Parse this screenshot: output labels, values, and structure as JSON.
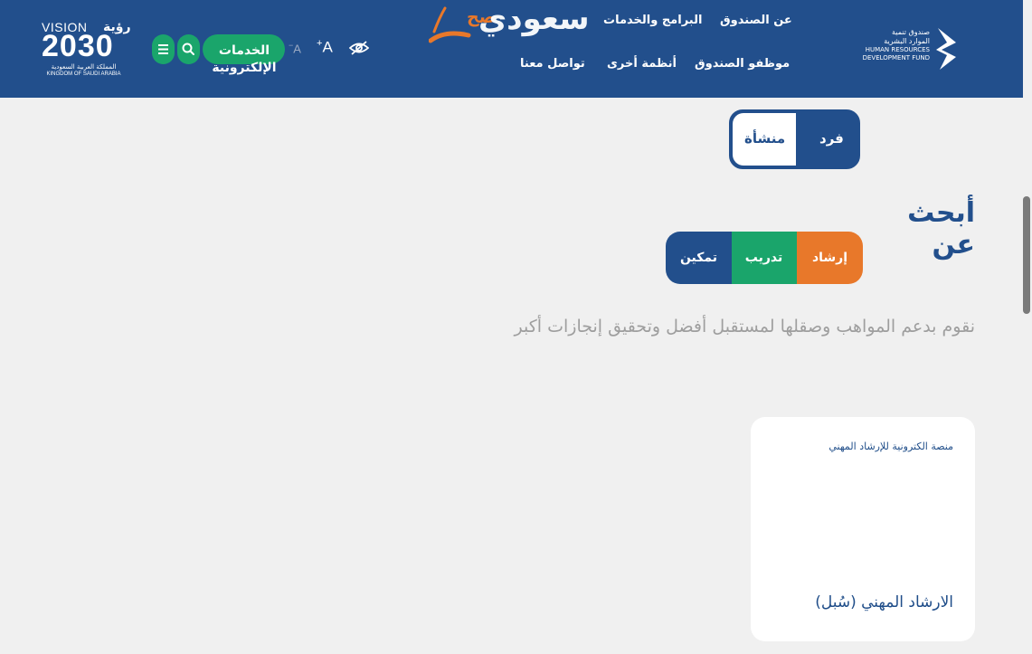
{
  "header": {
    "logo": {
      "ar_line1": "صندوق تنمية",
      "ar_line2": "الموارد البشرية",
      "en_line1": "HUMAN RESOURCES",
      "en_line2": "DEVELOPMENT FUND"
    },
    "nav": {
      "about": "عن الصندوق",
      "programs": "البرامج والخدمات",
      "employees": "موظفو الصندوق",
      "other_systems": "أنظمة أخرى",
      "contact": "تواصل معنا"
    },
    "watermark": {
      "text": "سعودي",
      "small": "صح"
    },
    "font_increase": "A",
    "font_decrease": "A",
    "eservices": {
      "line1": "الخدمات",
      "line2": "الإلكترونية"
    },
    "vision": {
      "word": "VISION",
      "ar": "رؤية",
      "year": "2030",
      "sub_ar": "المملكة العربية السعودية",
      "sub_en": "KINGDOM OF SAUDI ARABIA"
    }
  },
  "segment": {
    "individual": "فرد",
    "establishment": "منشأة"
  },
  "search_title": "أبحث عن",
  "tabs": [
    {
      "label": "إرشاد",
      "color": "#e8782a"
    },
    {
      "label": "تدريب",
      "color": "#1aa56b"
    },
    {
      "label": "تمكين",
      "color": "#224f8c"
    }
  ],
  "tagline": "نقوم بدعم المواهب وصقلها لمستقبل أفضل وتحقيق إنجازات أكبر",
  "card": {
    "subtitle": "منصة الكترونية للإرشاد المهني",
    "title": "الارشاد المهني (سُبل)"
  },
  "colors": {
    "primary": "#224f8c",
    "green": "#1aa56b",
    "orange": "#e8782a",
    "background": "#f0f0f0"
  }
}
